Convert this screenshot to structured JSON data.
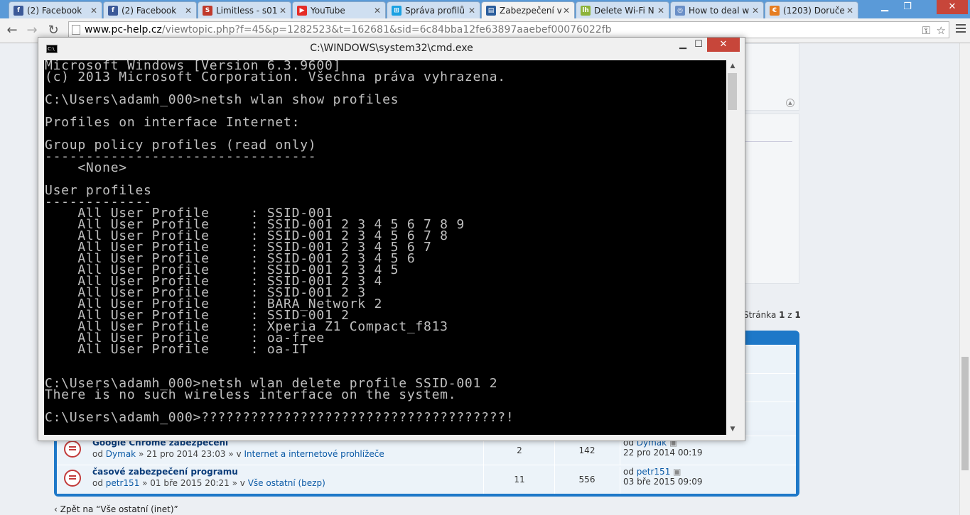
{
  "browser": {
    "tabs": [
      {
        "title": "(2) Facebook",
        "favicon": "facebook-icon",
        "color": "#3b5998",
        "glyph": "f"
      },
      {
        "title": "(2) Facebook",
        "favicon": "facebook-icon",
        "color": "#3b5998",
        "glyph": "f"
      },
      {
        "title": "Limitless - s01",
        "favicon": "s-icon",
        "color": "#c0392b",
        "glyph": "S"
      },
      {
        "title": "YouTube",
        "favicon": "youtube-icon",
        "color": "#e52d27",
        "glyph": "▶"
      },
      {
        "title": "Správa profilů",
        "favicon": "windows-icon",
        "color": "#1ba1e2",
        "glyph": "⊞"
      },
      {
        "title": "Zabezpečení v",
        "favicon": "pc-help-icon",
        "color": "#2a5d9c",
        "glyph": "▤"
      },
      {
        "title": "Delete Wi-Fi N",
        "favicon": "lh-icon",
        "color": "#8db33a",
        "glyph": "lh"
      },
      {
        "title": "How to deal w",
        "favicon": "globe-icon",
        "color": "#6a8fc7",
        "glyph": "◎"
      },
      {
        "title": "(1203) Doruče",
        "favicon": "euro-icon",
        "color": "#e67e22",
        "glyph": "€"
      }
    ],
    "active_tab": 5,
    "url_domain": "www.pc-help.cz",
    "url_rest": "/viewtopic.php?f=45&p=1282523&t=162681&sid=6c84bba12fe63897aaebef00076022fb"
  },
  "cmd": {
    "title": "C:\\WINDOWS\\system32\\cmd.exe",
    "lines": [
      "Microsoft Windows [Version 6.3.9600]",
      "(c) 2013 Microsoft Corporation. Všechna práva vyhrazena.",
      "",
      "C:\\Users\\adamh_000>netsh wlan show profiles",
      "",
      "Profiles on interface Internet:",
      "",
      "Group policy profiles (read only)",
      "---------------------------------",
      "    <None>",
      "",
      "User profiles",
      "-------------",
      "    All User Profile     : SSID-001",
      "    All User Profile     : SSID-001 2 3 4 5 6 7 8 9",
      "    All User Profile     : SSID-001 2 3 4 5 6 7 8",
      "    All User Profile     : SSID-001 2 3 4 5 6 7",
      "    All User Profile     : SSID-001 2 3 4 5 6",
      "    All User Profile     : SSID-001 2 3 4 5",
      "    All User Profile     : SSID-001 2 3 4",
      "    All User Profile     : SSID-001 2 3",
      "    All User Profile     : BARA_Network 2",
      "    All User Profile     : SSID-001 2",
      "    All User Profile     : Xperia Z1 Compact_f813",
      "    All User Profile     : oa-free",
      "    All User Profile     : oa-IT",
      "",
      "",
      "C:\\Users\\adamh_000>netsh wlan delete profile SSID-001 2",
      "There is no such wireless interface on the system.",
      "",
      "C:\\Users\\adamh_000>?????????????????????????????????????!"
    ]
  },
  "forum": {
    "pagination": {
      "prefix": "Stránka ",
      "current": "1",
      "sep": " z ",
      "total": "1"
    },
    "topics": [
      {
        "title": "Google Chrome zabezpečení",
        "author_prefix": "od ",
        "author": "Dymak",
        "date": " » 21 pro 2014 23:03 » v ",
        "forum": "Internet a internetové prohlížeče",
        "replies": "2",
        "views": "142",
        "last_prefix": "od ",
        "last_author": "Dymak",
        "last_date": "22 pro 2014 00:19"
      },
      {
        "title": "časové zabezpečení programu",
        "author_prefix": "od ",
        "author": "petr151",
        "date": " » 01 bře 2015 20:21 » v ",
        "forum": "Vše ostatní (bezp)",
        "replies": "11",
        "views": "556",
        "last_prefix": "od ",
        "last_author": "petr151",
        "last_date": "03 bře 2015 09:09"
      }
    ],
    "back_link": "Zpět na “Vše ostatní (inet)”"
  }
}
